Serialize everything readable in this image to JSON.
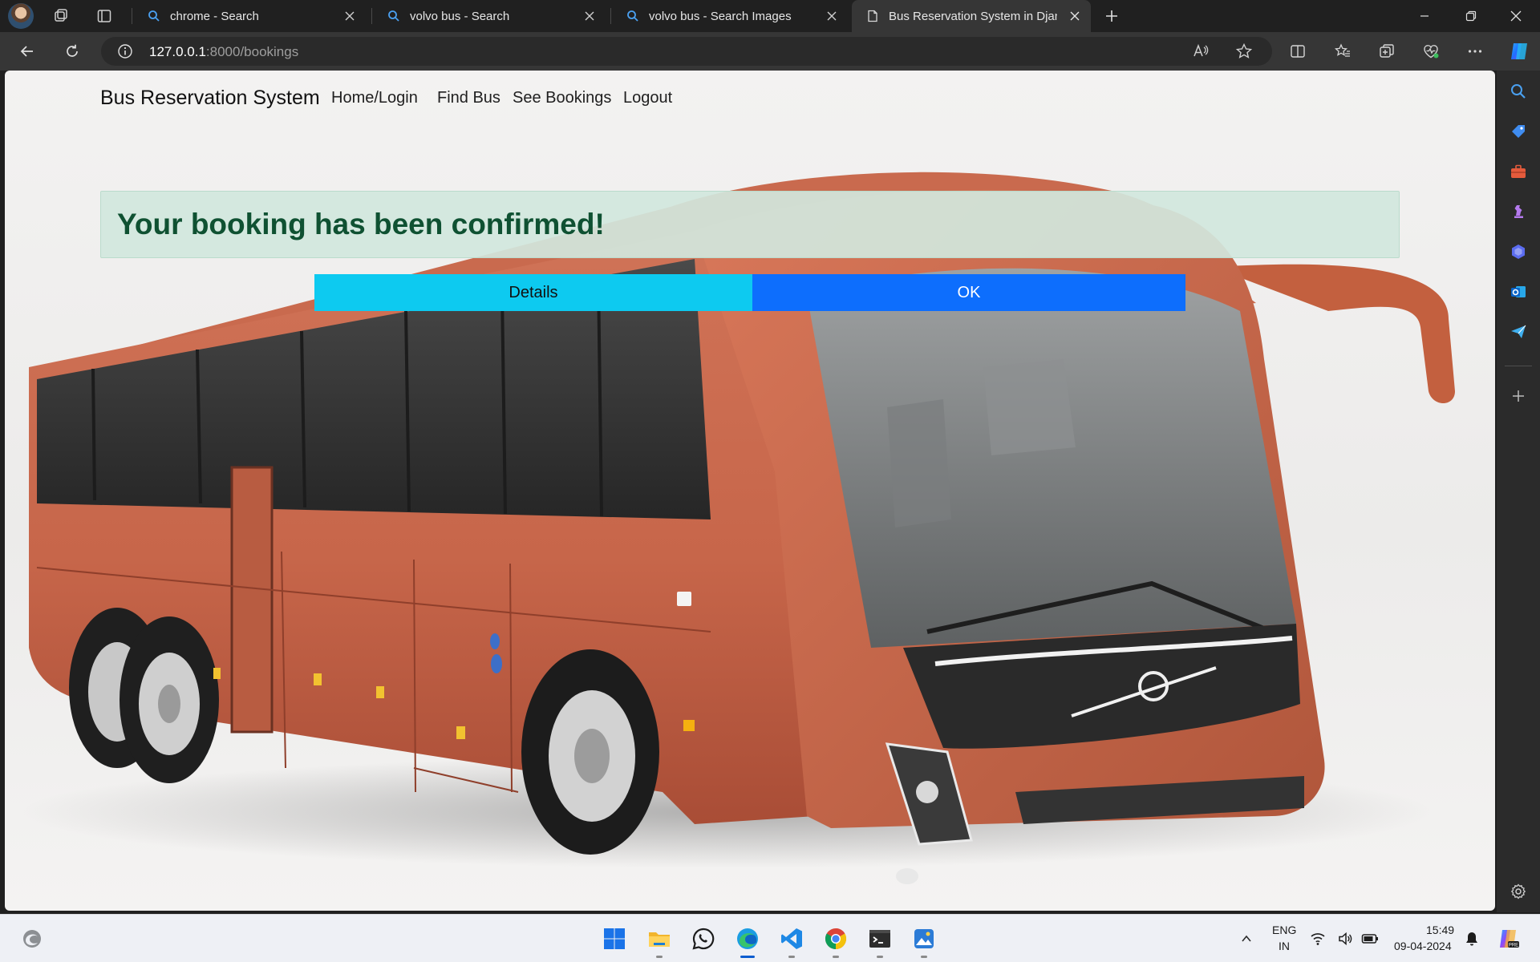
{
  "browser": {
    "tabs": [
      {
        "title": "chrome - Search",
        "icon": "search-icon"
      },
      {
        "title": "volvo bus - Search",
        "icon": "search-icon"
      },
      {
        "title": "volvo bus - Search Images",
        "icon": "search-icon"
      },
      {
        "title": "Bus Reservation System in Djang",
        "icon": "page-icon",
        "active": true
      }
    ],
    "address": {
      "host": "127.0.0.1",
      "path": ":8000/bookings"
    },
    "accent": "#0078d4"
  },
  "page": {
    "brand": "Bus Reservation System",
    "nav": [
      "Home/Login",
      "Find Bus",
      "See Bookings",
      "Logout"
    ],
    "alert": {
      "message": "Your booking has been confirmed!",
      "color": "#0f5132",
      "background": "#d1e7dd"
    },
    "buttons": {
      "details_label": "Details",
      "ok_label": "OK",
      "details_color": "#0dcaf0",
      "ok_color": "#0d6efd"
    },
    "background_image": "orange-volvo-coach-bus"
  },
  "taskbar": {
    "apps": [
      "start-icon",
      "file-explorer-icon",
      "whatsapp-icon",
      "edge-icon",
      "vscode-icon",
      "chrome-icon",
      "terminal-icon",
      "photos-icon"
    ],
    "language": {
      "line1": "ENG",
      "line2": "IN"
    },
    "clock": {
      "time": "15:49",
      "date": "09-04-2024"
    }
  }
}
